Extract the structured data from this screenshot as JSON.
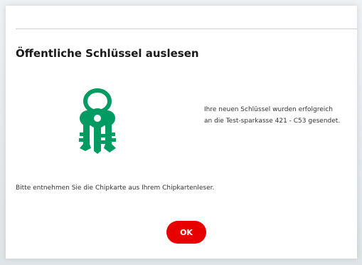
{
  "dialog": {
    "title": "Öffentliche Schlüssel auslesen",
    "icon": "keys-icon",
    "message": "Ihre neuen Schlüssel wurden erfolgreich\nan die Test-sparkasse 421 - C53 gesendet.",
    "instruction": "Bitte entnehmen Sie die Chipkarte aus Ihrem Chipkartenleser.",
    "ok_label": "OK"
  },
  "colors": {
    "accent": "#e60000",
    "icon": "#009a63",
    "text": "#333333"
  }
}
